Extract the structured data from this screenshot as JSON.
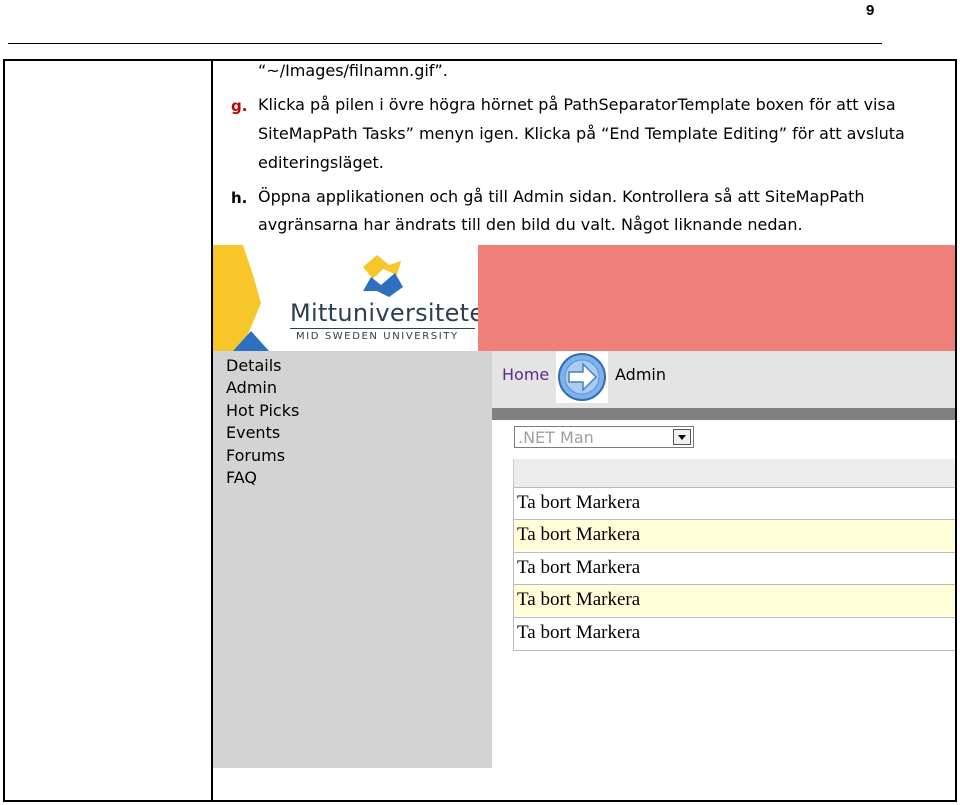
{
  "header": {
    "page_number": "9"
  },
  "content": {
    "path_line": "“~/Images/filnamn.gif”.",
    "step_g": {
      "letter": "g.",
      "line1": "Klicka på pilen i övre högra hörnet på PathSeparatorTemplate boxen för att visa",
      "line2": "SiteMapPath Tasks” menyn igen. Klicka på “End Template Editing” för att avsluta",
      "line3": "editeringsläget."
    },
    "step_h": {
      "letter": "h.",
      "line1": "Öppna applikationen och gå till Admin sidan. Kontrollera så att SiteMapPath",
      "line2": "avgränsarna har ändrats till den bild du valt. Något liknande nedan."
    }
  },
  "screenshot": {
    "logo": {
      "name": "Mittuniversitetet",
      "subtitle": "MID SWEDEN UNIVERSITY"
    },
    "menu": [
      "Details",
      "Admin",
      "Hot Picks",
      "Events",
      "Forums",
      "FAQ"
    ],
    "breadcrumb": {
      "home": "Home",
      "current": "Admin",
      "separator_icon": "arrow-right-circle-icon"
    },
    "dropdown_value": ".NET Man",
    "rows": [
      "Ta bort Markera",
      "Ta bort Markera",
      "Ta bort Markera",
      "Ta bort Markera",
      "Ta bort Markera"
    ],
    "colors": {
      "header_red": "#ef7f7b",
      "sidebar_grey": "#d3d3d3",
      "row_alt": "#fffed8",
      "logo_yellow": "#f7c62a",
      "logo_blue": "#2e6fc0"
    }
  }
}
